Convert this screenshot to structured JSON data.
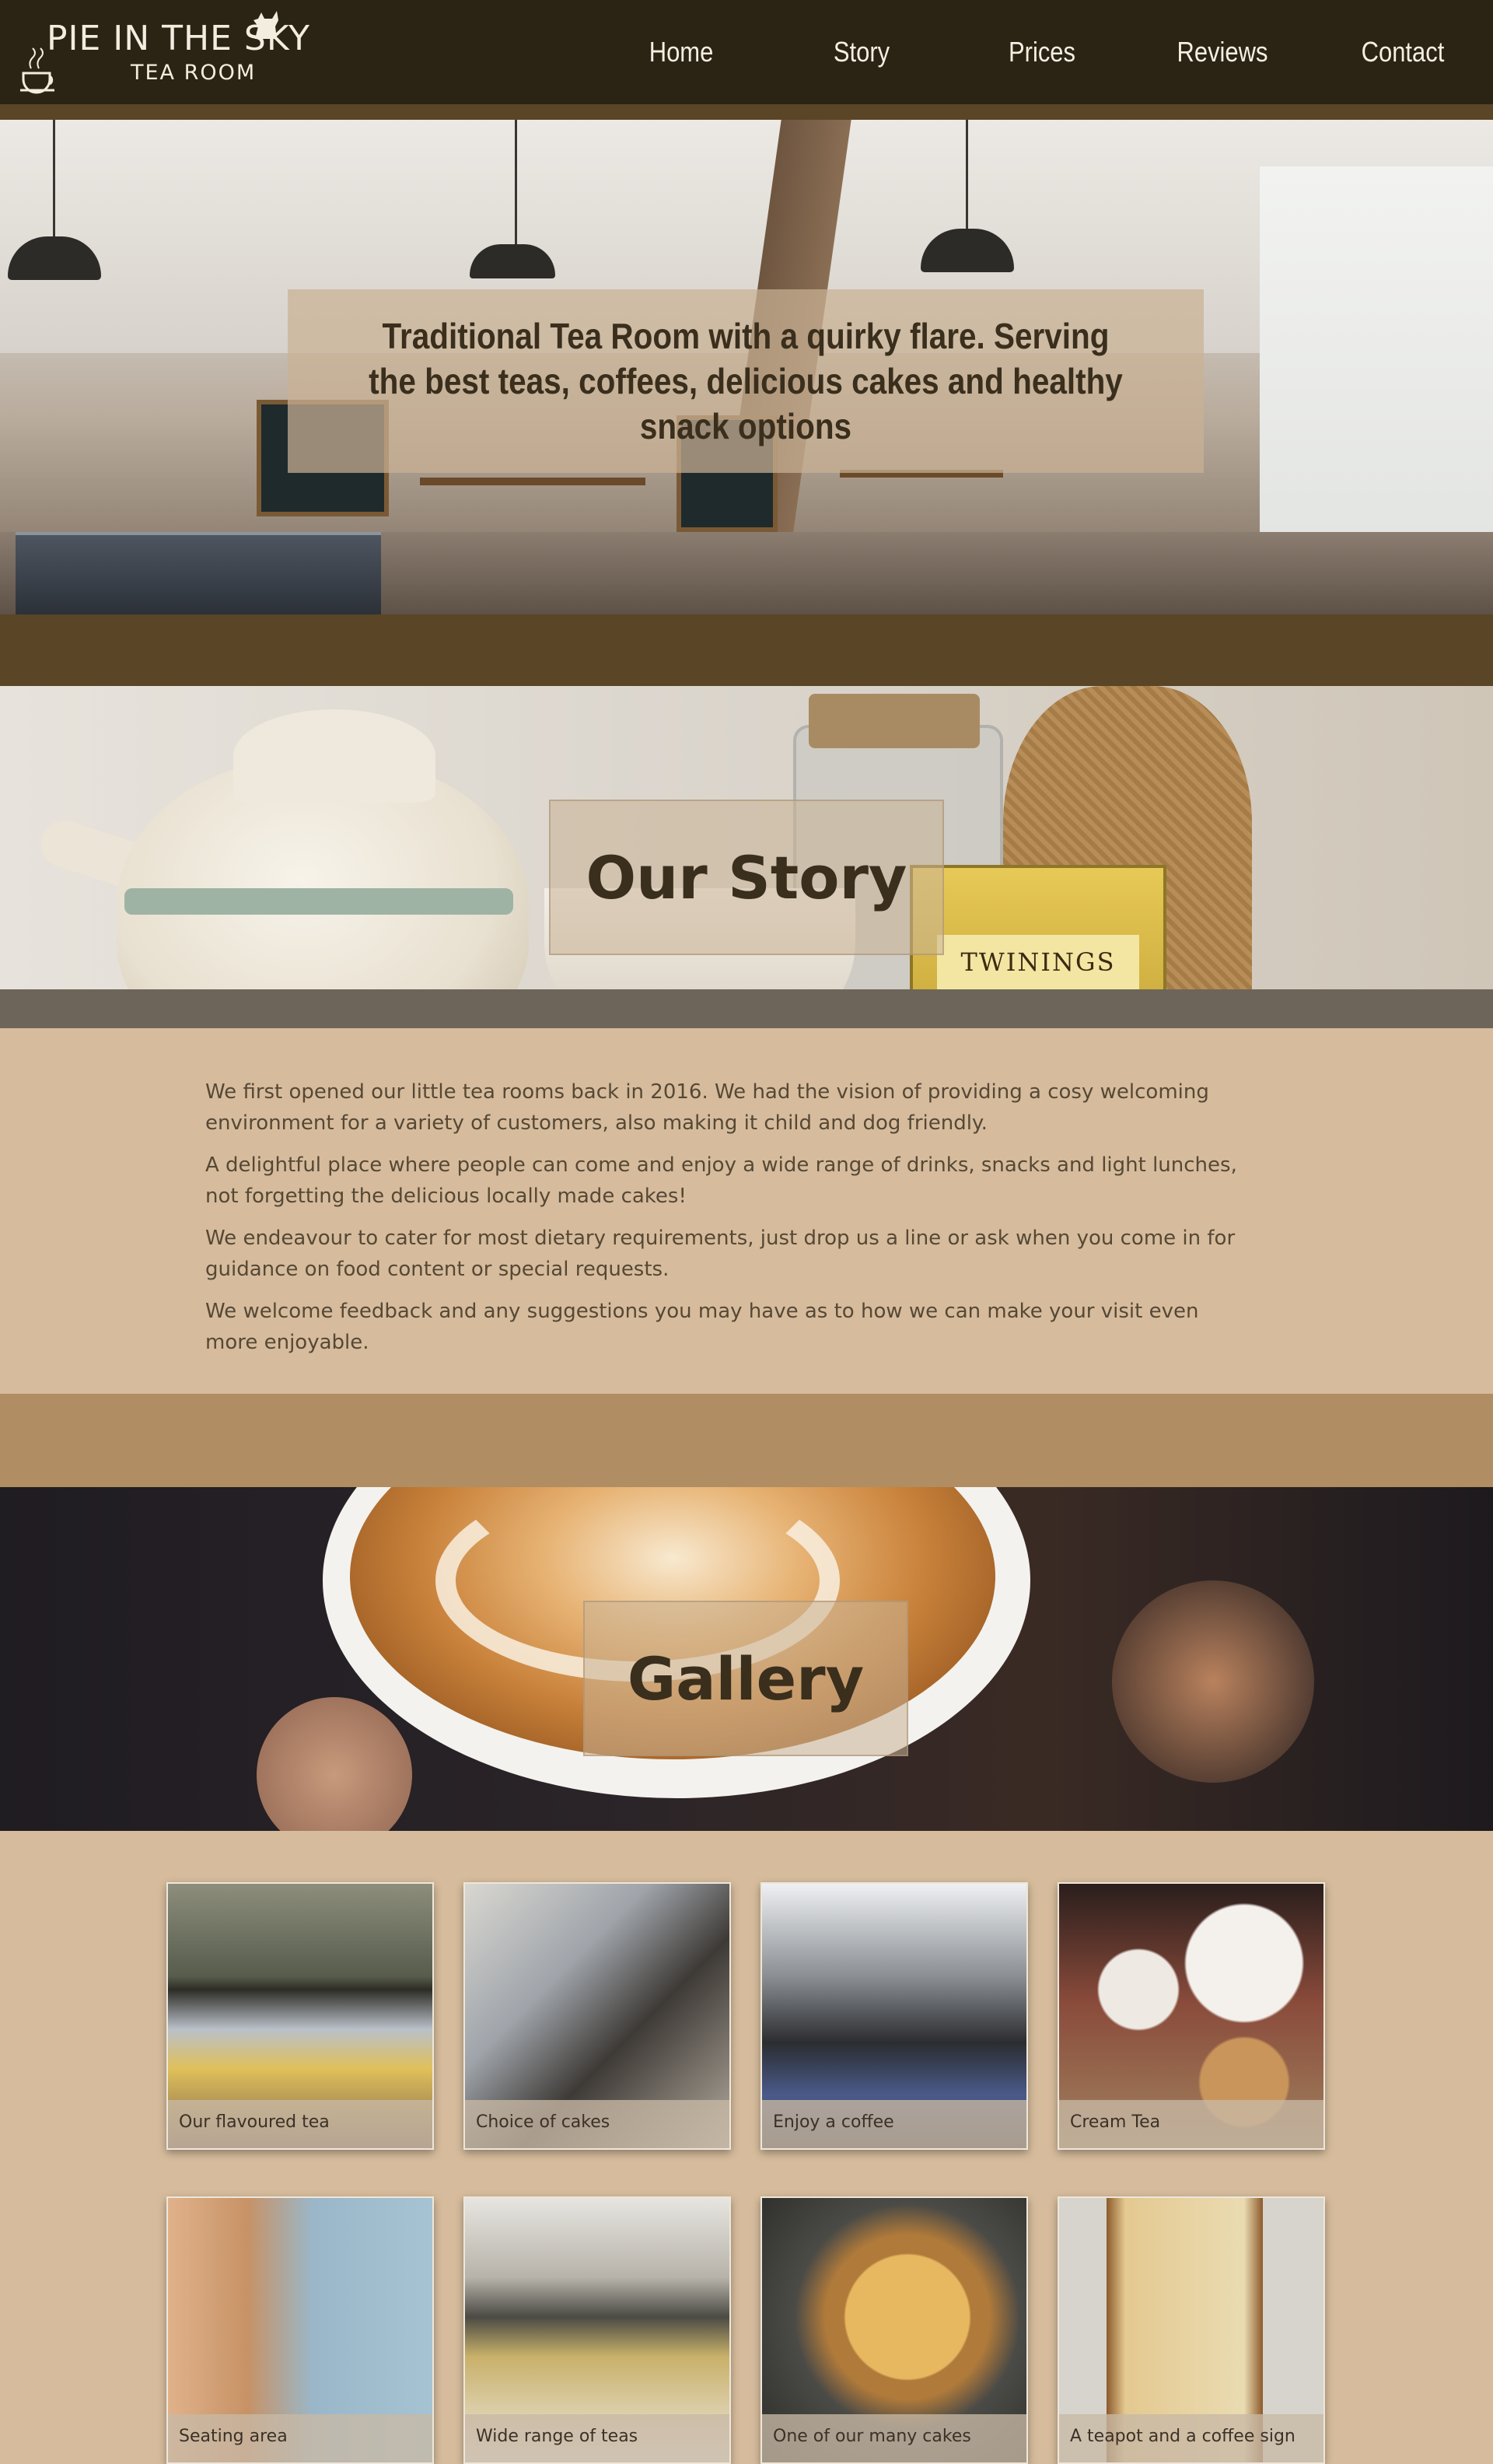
{
  "brand": {
    "title": "PIE IN THE SKY",
    "subtitle": "TEA ROOM"
  },
  "nav": {
    "items": [
      {
        "label": "Home"
      },
      {
        "label": "Story"
      },
      {
        "label": "Prices"
      },
      {
        "label": "Reviews"
      },
      {
        "label": "Contact"
      }
    ]
  },
  "hero": {
    "tagline": "Traditional Tea Room with a quirky flare. Serving the best teas, coffees, delicious cakes and healthy snack options",
    "scroll_icon": "chevron-down-icon"
  },
  "story": {
    "heading": "Our Story",
    "tin_label": "TWININGS",
    "paragraphs": [
      "We first opened our little tea rooms back in 2016. We had the vision of providing a cosy welcoming environment for a variety of customers, also making it child and dog friendly.",
      "A delightful place where people can come and enjoy a wide range of drinks, snacks and light lunches, not forgetting the delicious locally made cakes!",
      "We endeavour to cater for most dietary requirements, just drop us a line or ask when you come in for guidance on food content or special requests.",
      "We welcome feedback and any suggestions you may have as to how we can make your visit even more enjoyable."
    ]
  },
  "gallery": {
    "heading": "Gallery",
    "items": [
      {
        "caption": "Our flavoured tea"
      },
      {
        "caption": "Choice of cakes"
      },
      {
        "caption": "Enjoy a coffee"
      },
      {
        "caption": "Cream Tea"
      },
      {
        "caption": "Seating area"
      },
      {
        "caption": "Wide range of teas"
      },
      {
        "caption": "One of our many cakes"
      },
      {
        "caption": "A teapot and a coffee sign"
      }
    ]
  },
  "colors": {
    "nav_bg": "#2b2314",
    "accent_brown": "#5a4526",
    "page_tan": "#d6bc9c",
    "band_tan": "#b08d62",
    "text_dark": "#3a2e1d"
  }
}
